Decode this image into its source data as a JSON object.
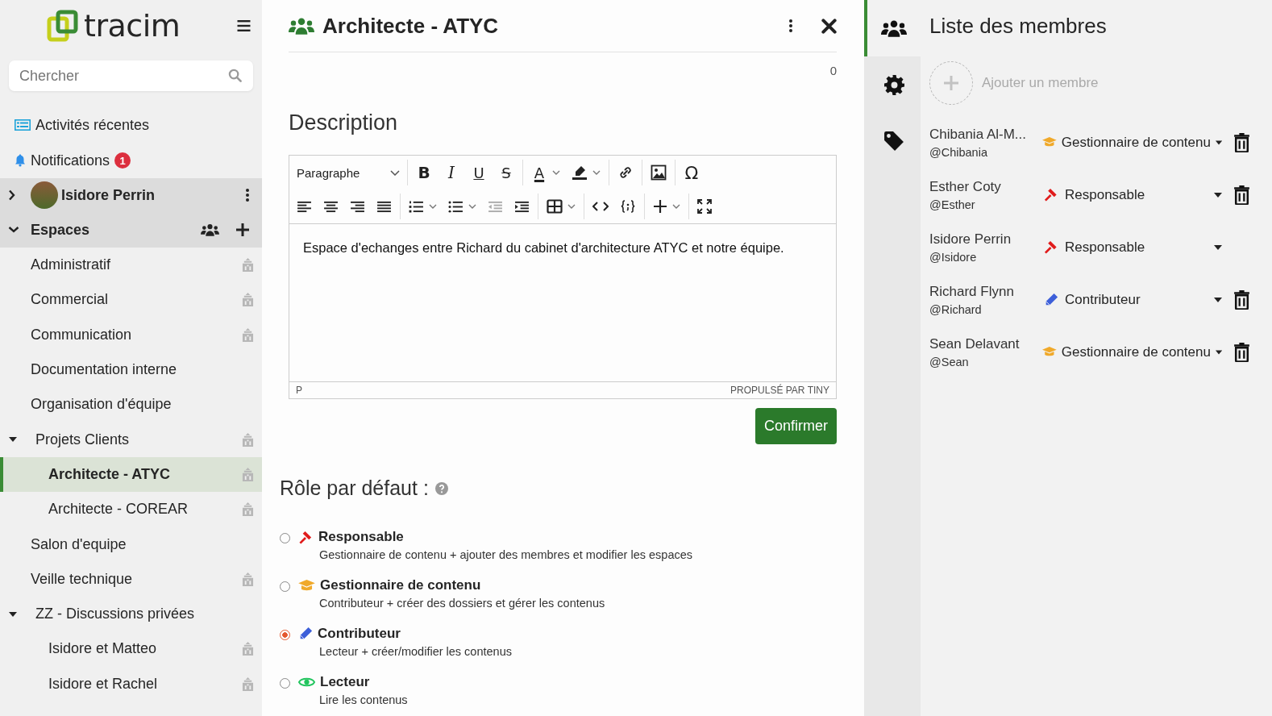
{
  "logo": {
    "text": "tracim"
  },
  "search": {
    "placeholder": "Chercher"
  },
  "nav": [
    {
      "kind": "activity",
      "label": "Activités récentes"
    },
    {
      "kind": "notifications",
      "label": "Notifications",
      "badge": "1"
    }
  ],
  "user": {
    "name": "Isidore Perrin",
    "expanded": false
  },
  "spaces": {
    "label": "Espaces",
    "expanded": true,
    "items": [
      {
        "name": "Administratif",
        "selected": false,
        "building_icon": true
      },
      {
        "name": "Commercial",
        "selected": false,
        "building_icon": true
      },
      {
        "name": "Communication",
        "selected": false,
        "building_icon": true
      },
      {
        "name": "Documentation interne",
        "selected": false,
        "building_icon": false
      },
      {
        "name": "Organisation d'équipe",
        "selected": false,
        "building_icon": false
      },
      {
        "name": "Projets Clients",
        "selected": false,
        "building_icon": true,
        "expanded": true,
        "children": [
          {
            "name": "Architecte - ATYC",
            "selected": true,
            "building_icon": true
          },
          {
            "name": "Architecte - COREAR",
            "selected": false,
            "building_icon": true
          }
        ]
      },
      {
        "name": "Salon d'equipe",
        "selected": false,
        "building_icon": false
      },
      {
        "name": "Veille technique",
        "selected": false,
        "building_icon": true
      },
      {
        "name": "ZZ - Discussions privées",
        "selected": false,
        "building_icon": false,
        "expanded": true,
        "children": [
          {
            "name": "Isidore et Matteo",
            "selected": false,
            "building_icon": true
          },
          {
            "name": "Isidore et Rachel",
            "selected": false,
            "building_icon": true
          }
        ]
      }
    ]
  },
  "panel": {
    "title": "Architecte - ATYC",
    "counter": "0",
    "section": "Description",
    "editor": {
      "format": "Paragraphe",
      "toolbar": [
        [
          {
            "kind": "bold",
            "glyph": "B"
          },
          {
            "kind": "italic",
            "glyph": "I"
          },
          {
            "kind": "underline",
            "glyph": "U"
          },
          {
            "kind": "strike",
            "glyph": "S"
          },
          {
            "kind": "textcolor",
            "glyph": "A",
            "dropdown": true
          },
          {
            "kind": "highlight",
            "dropdown": true
          },
          {
            "kind": "link"
          },
          {
            "kind": "image"
          },
          {
            "kind": "special",
            "glyph": "Ω"
          }
        ],
        [
          {
            "kind": "align-left"
          },
          {
            "kind": "align-center"
          },
          {
            "kind": "align-right"
          },
          {
            "kind": "justify"
          },
          {
            "kind": "numlist",
            "dropdown": true
          },
          {
            "kind": "bullist",
            "dropdown": true
          },
          {
            "kind": "outdent",
            "disabled": true
          },
          {
            "kind": "indent"
          },
          {
            "kind": "table",
            "dropdown": true
          },
          {
            "kind": "code"
          },
          {
            "kind": "codesample"
          },
          {
            "kind": "insert",
            "dropdown": true
          },
          {
            "kind": "fullscreen"
          }
        ]
      ],
      "content": "Espace d'echanges entre Richard du cabinet d'architecture ATYC et notre équipe.",
      "path": "P",
      "branding": "PROPULSÉ PAR TINY"
    },
    "confirm": "Confirmer",
    "roles_title": "Rôle par défaut :",
    "roles": [
      {
        "kind": "gavel",
        "name": "Responsable",
        "description": "Gestionnaire de contenu + ajouter des membres et modifier les espaces",
        "selected": false
      },
      {
        "kind": "cap",
        "name": "Gestionnaire de contenu",
        "description": "Contributeur + créer des dossiers et gérer les contenus",
        "selected": false
      },
      {
        "kind": "pencil",
        "name": "Contributeur",
        "description": "Lecteur + créer/modifier les contenus",
        "selected": true
      },
      {
        "kind": "eye",
        "name": "Lecteur",
        "description": "Lire les contenus",
        "selected": false
      }
    ]
  },
  "side_tabs": [
    {
      "kind": "members",
      "selected": true
    },
    {
      "kind": "settings",
      "selected": false
    },
    {
      "kind": "tags",
      "selected": false
    }
  ],
  "members_panel": {
    "title": "Liste des membres",
    "add": "Ajouter un membre",
    "members": [
      {
        "name": "Chibania Al-M...",
        "username": "@Chibania",
        "role": {
          "kind": "cap",
          "label": "Gestionnaire de contenu"
        },
        "deletable": true
      },
      {
        "name": "Esther Coty",
        "username": "@Esther",
        "role": {
          "kind": "gavel",
          "label": "Responsable"
        },
        "deletable": true
      },
      {
        "name": "Isidore Perrin",
        "username": "@Isidore",
        "role": {
          "kind": "gavel",
          "label": "Responsable"
        },
        "deletable": false
      },
      {
        "name": "Richard Flynn",
        "username": "@Richard",
        "role": {
          "kind": "pencil",
          "label": "Contributeur"
        },
        "deletable": true
      },
      {
        "name": "Sean Delavant",
        "username": "@Sean",
        "role": {
          "kind": "cap",
          "label": "Gestionnaire de contenu"
        },
        "deletable": true
      }
    ]
  }
}
